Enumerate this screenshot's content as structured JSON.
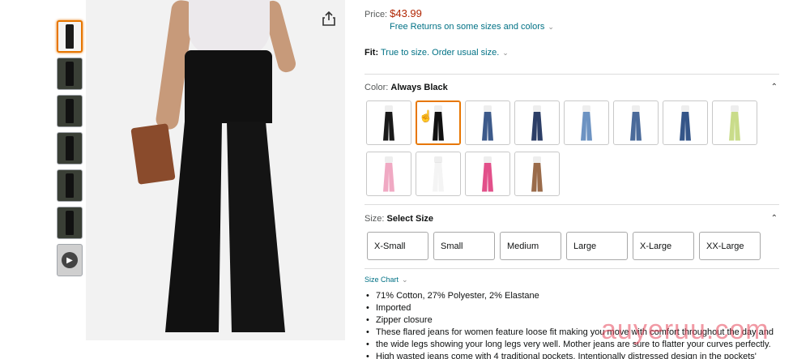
{
  "price": {
    "label": "Price:",
    "value": "$43.99"
  },
  "returns": {
    "text": "Free Returns on some sizes and colors"
  },
  "fit": {
    "label": "Fit:",
    "text": "True to size. Order usual size."
  },
  "color_section": {
    "label": "Color:",
    "selected": "Always Black"
  },
  "color_swatches": [
    {
      "color": "#1a1a1a"
    },
    {
      "color": "#111111"
    },
    {
      "color": "#3d5a8a"
    },
    {
      "color": "#2c3e66"
    },
    {
      "color": "#6d93c2"
    },
    {
      "color": "#4a6a9a"
    },
    {
      "color": "#345588"
    },
    {
      "color": "#c9dc8a"
    },
    {
      "color": "#f0a9c3"
    },
    {
      "color": "#f4f4f4"
    },
    {
      "color": "#e2508a"
    },
    {
      "color": "#9a6b4a"
    }
  ],
  "size_section": {
    "label": "Size:",
    "selected": "Select Size"
  },
  "sizes": [
    "X-Small",
    "Small",
    "Medium",
    "Large",
    "X-Large",
    "XX-Large"
  ],
  "size_chart": "Size Chart",
  "bullets": [
    "71% Cotton, 27% Polyester, 2% Elastane",
    "Imported",
    "Zipper closure",
    "These flared jeans for women feature loose fit making you move with comfort throughout the day and",
    "the wide legs showing your long legs very well. Mother jeans are sure to flatter your curves perfectly.",
    "High wasted jeans come with 4 traditional pockets. Intentionally distressed design in the pockets'"
  ],
  "watermark": "auyeruu.com",
  "icons": {
    "share": "share-icon",
    "collapse": "chevron-up-icon",
    "play": "play-icon"
  }
}
